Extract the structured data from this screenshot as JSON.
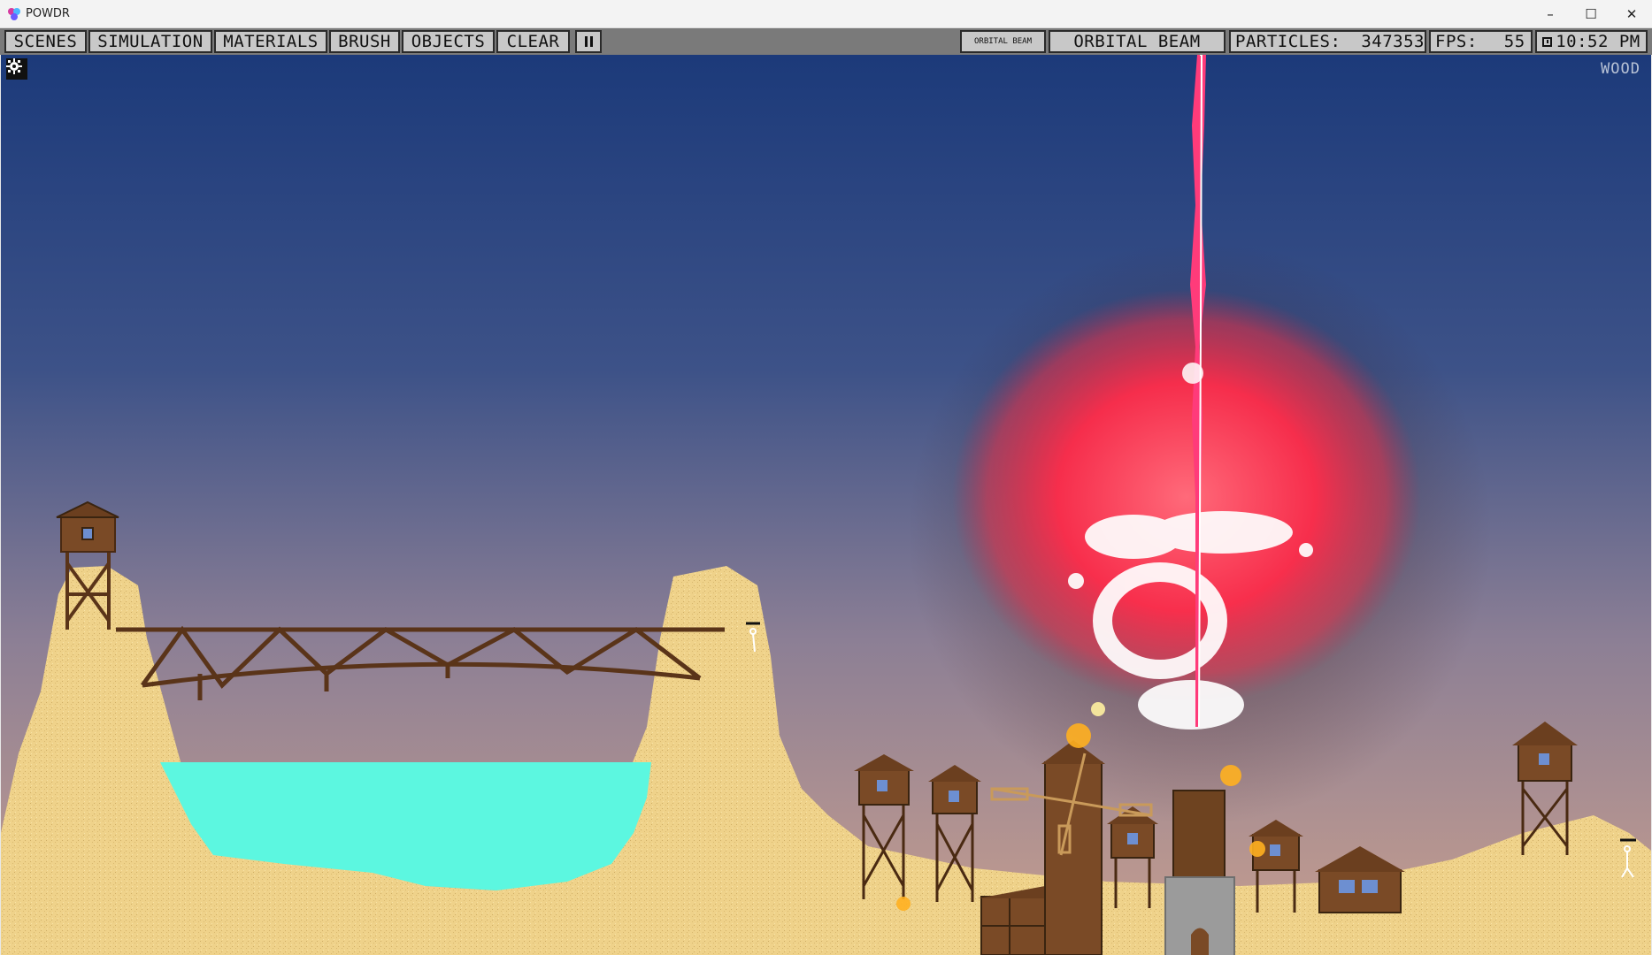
{
  "window": {
    "title": "POWDR",
    "controls": {
      "minimize": "–",
      "maximize": "☐",
      "close": "✕"
    }
  },
  "toolbar": {
    "menus": [
      "SCENES",
      "SIMULATION",
      "MATERIALS",
      "BRUSH",
      "OBJECTS",
      "CLEAR"
    ],
    "selected_material_preview": "ORBITAL BEAM",
    "selected_material": "ORBITAL BEAM",
    "particles_label": "PARTICLES:",
    "particles_value": "347353",
    "fps_label": "FPS:",
    "fps_value": "55",
    "time": "10:52 PM"
  },
  "viewport": {
    "hover_material": "WOOD"
  },
  "colors": {
    "sky_top": "#1c3a7a",
    "sky_bottom": "#c29a8f",
    "sand": "#f0d38a",
    "water": "#5cf7e0",
    "wood": "#7a4a26",
    "beam": "#ff3b7a",
    "explosion": "#ff2c4a",
    "stone": "#9b9b9b"
  }
}
